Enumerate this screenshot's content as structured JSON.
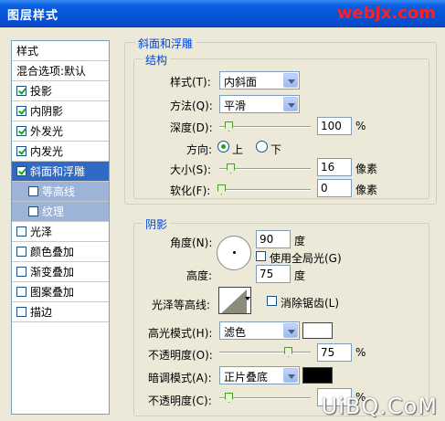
{
  "window": {
    "title": "图层样式",
    "watermark": "webjx.com"
  },
  "styles_list": {
    "header": "样式",
    "blend": "混合选项:默认",
    "items": [
      {
        "label": "投影",
        "checked": true
      },
      {
        "label": "内阴影",
        "checked": true
      },
      {
        "label": "外发光",
        "checked": true
      },
      {
        "label": "内发光",
        "checked": true
      },
      {
        "label": "斜面和浮雕",
        "checked": true,
        "selected": true
      },
      {
        "label": "等高线",
        "checked": false,
        "sub": true
      },
      {
        "label": "纹理",
        "checked": false,
        "sub": true
      },
      {
        "label": "光泽",
        "checked": false
      },
      {
        "label": "颜色叠加",
        "checked": false
      },
      {
        "label": "渐变叠加",
        "checked": false
      },
      {
        "label": "图案叠加",
        "checked": false
      },
      {
        "label": "描边",
        "checked": false
      }
    ]
  },
  "bevel": {
    "section_title": "斜面和浮雕",
    "structure_title": "结构",
    "style_label": "样式(T):",
    "style_value": "内斜面",
    "technique_label": "方法(Q):",
    "technique_value": "平滑",
    "depth_label": "深度(D):",
    "depth_value": "100",
    "depth_unit": "%",
    "direction_label": "方向:",
    "direction_up": "上",
    "direction_down": "下",
    "size_label": "大小(S):",
    "size_value": "16",
    "size_unit": "像素",
    "soften_label": "软化(F):",
    "soften_value": "0",
    "soften_unit": "像素"
  },
  "shading": {
    "title": "阴影",
    "angle_label": "角度(N):",
    "angle_value": "90",
    "angle_unit": "度",
    "global_light_label": "使用全局光(G)",
    "altitude_label": "高度:",
    "altitude_value": "75",
    "altitude_unit": "度",
    "gloss_label": "光泽等高线:",
    "antialias_label": "消除锯齿(L)",
    "highlight_label": "高光模式(H):",
    "highlight_value": "滤色",
    "highlight_color": "#ffffff",
    "highlight_opacity_label": "不透明度(O):",
    "highlight_opacity_value": "75",
    "shadow_label": "暗调模式(A):",
    "shadow_value": "正片叠底",
    "shadow_color": "#000000",
    "shadow_opacity_label": "不透明度(C):",
    "shadow_opacity_value": "",
    "percent": "%"
  },
  "footer_watermark": "UiBQ.CoM"
}
